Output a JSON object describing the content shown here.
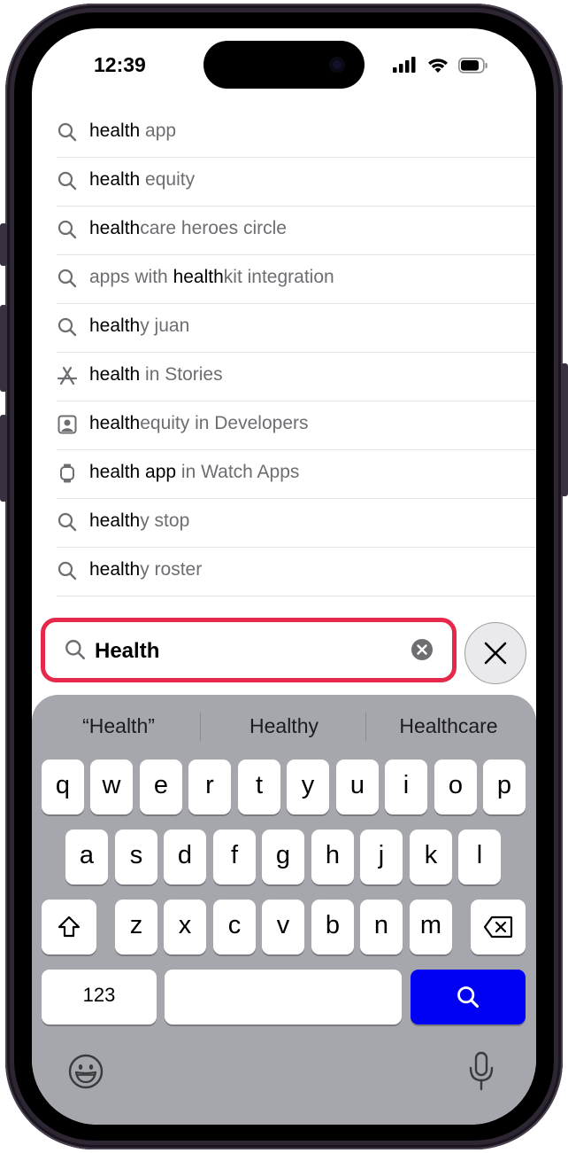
{
  "status_bar": {
    "time": "12:39"
  },
  "suggestions": [
    {
      "icon": "search-icon",
      "bold": "health",
      "rest": " app",
      "prefix": ""
    },
    {
      "icon": "search-icon",
      "bold": "health",
      "rest": " equity",
      "prefix": ""
    },
    {
      "icon": "search-icon",
      "bold": "health",
      "rest": "care heroes circle",
      "prefix": ""
    },
    {
      "icon": "search-icon",
      "bold": "health",
      "rest": "kit integration",
      "prefix": "apps with "
    },
    {
      "icon": "search-icon",
      "bold": "health",
      "rest": "y juan",
      "prefix": ""
    },
    {
      "icon": "app-store-icon",
      "bold": "health",
      "rest": " in Stories",
      "prefix": ""
    },
    {
      "icon": "developer-icon",
      "bold": "health",
      "rest": "equity in Developers",
      "prefix": ""
    },
    {
      "icon": "watch-icon",
      "bold": "health app",
      "rest": " in Watch Apps",
      "prefix": ""
    },
    {
      "icon": "search-icon",
      "bold": "health",
      "rest": "y stop",
      "prefix": ""
    },
    {
      "icon": "search-icon",
      "bold": "health",
      "rest": "y roster",
      "prefix": ""
    }
  ],
  "search": {
    "value": "Health",
    "highlight_color": "#e6284a"
  },
  "keyboard": {
    "predictions": [
      "“Health”",
      "Healthy",
      "Healthcare"
    ],
    "row1": [
      "q",
      "w",
      "e",
      "r",
      "t",
      "y",
      "u",
      "i",
      "o",
      "p"
    ],
    "row2": [
      "a",
      "s",
      "d",
      "f",
      "g",
      "h",
      "j",
      "k",
      "l"
    ],
    "row3": [
      "z",
      "x",
      "c",
      "v",
      "b",
      "n",
      "m"
    ],
    "numbers_label": "123",
    "search_key_color": "#0000f5"
  }
}
